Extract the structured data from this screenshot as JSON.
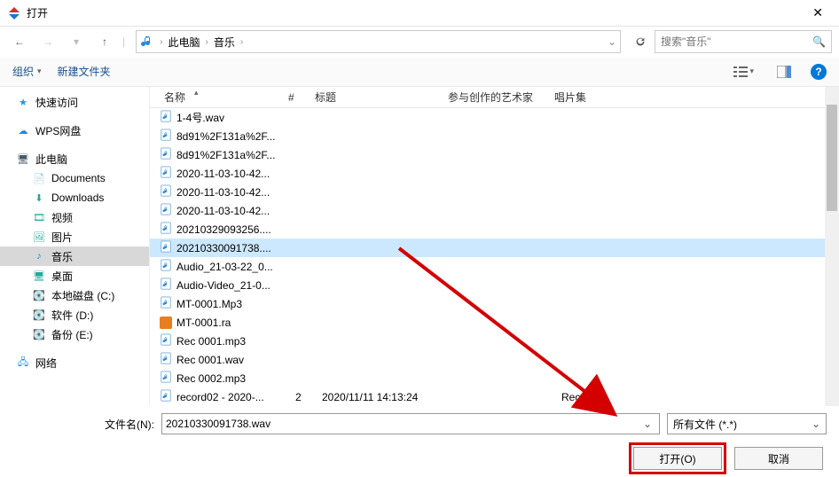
{
  "window": {
    "title": "打开",
    "close": "✕"
  },
  "nav": {
    "back": "←",
    "fwd": "→",
    "dd": "▾",
    "up": "↑"
  },
  "path": {
    "seg1": "此电脑",
    "seg2": "音乐",
    "chev": "›"
  },
  "search": {
    "placeholder": "搜索\"音乐\""
  },
  "toolbar": {
    "organize": "组织",
    "newfolder": "新建文件夹"
  },
  "sidebar": {
    "quick": "快速访问",
    "wps": "WPS网盘",
    "thispc": "此电脑",
    "docs": "Documents",
    "downloads": "Downloads",
    "videos": "视频",
    "pictures": "图片",
    "music": "音乐",
    "desktop": "桌面",
    "localc": "本地磁盘 (C:)",
    "softd": "软件 (D:)",
    "backupe": "备份 (E:)",
    "network": "网络"
  },
  "columns": {
    "name": "名称",
    "num": "#",
    "title": "标题",
    "artist": "参与创作的艺术家",
    "album": "唱片集"
  },
  "files": [
    {
      "name": "1-4号.wav",
      "type": "audio"
    },
    {
      "name": "8d91%2F131a%2F...",
      "type": "audio"
    },
    {
      "name": "8d91%2F131a%2F...",
      "type": "audio"
    },
    {
      "name": "2020-11-03-10-42...",
      "type": "audio"
    },
    {
      "name": "2020-11-03-10-42...",
      "type": "audio"
    },
    {
      "name": "2020-11-03-10-42...",
      "type": "audio"
    },
    {
      "name": "20210329093256....",
      "type": "audio"
    },
    {
      "name": "20210330091738....",
      "type": "audio",
      "selected": true
    },
    {
      "name": "Audio_21-03-22_0...",
      "type": "audio"
    },
    {
      "name": "Audio-Video_21-0...",
      "type": "audio"
    },
    {
      "name": "MT-0001.Mp3",
      "type": "audio"
    },
    {
      "name": "MT-0001.ra",
      "type": "ra"
    },
    {
      "name": "Rec 0001.mp3",
      "type": "audio"
    },
    {
      "name": "Rec 0001.wav",
      "type": "audio"
    },
    {
      "name": "Rec 0002.mp3",
      "type": "audio"
    },
    {
      "name": "record02 - 2020-...",
      "type": "audio",
      "num": "2",
      "title": "2020/11/11 14:13:24",
      "album": "Records"
    }
  ],
  "footer": {
    "fn_label": "文件名(N):",
    "fn_value": "20210330091738.wav",
    "filter": "所有文件 (*.*)",
    "open": "打开(O)",
    "cancel": "取消"
  }
}
